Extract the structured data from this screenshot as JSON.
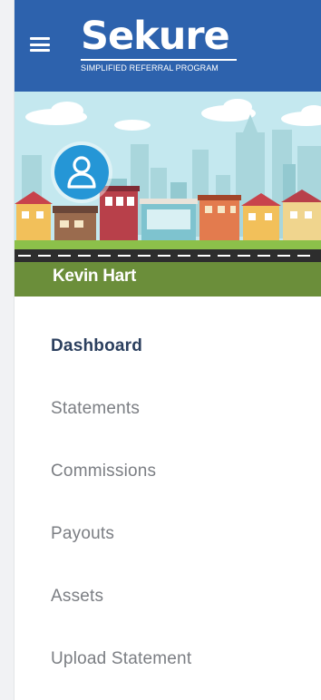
{
  "brand": {
    "name": "Sekure",
    "tagline": "SIMPLIFIED REFERRAL PROGRAM",
    "color": "#2d62ad"
  },
  "user": {
    "name": "Kevin Hart",
    "avatar_icon": "user-icon",
    "avatar_color": "#2596d6"
  },
  "nav": {
    "items": [
      {
        "label": "Dashboard",
        "active": true
      },
      {
        "label": "Statements",
        "active": false
      },
      {
        "label": "Commissions",
        "active": false
      },
      {
        "label": "Payouts",
        "active": false
      },
      {
        "label": "Assets",
        "active": false
      },
      {
        "label": "Upload Statement",
        "active": false
      }
    ]
  },
  "icons": {
    "menu": "hamburger-menu-icon"
  }
}
